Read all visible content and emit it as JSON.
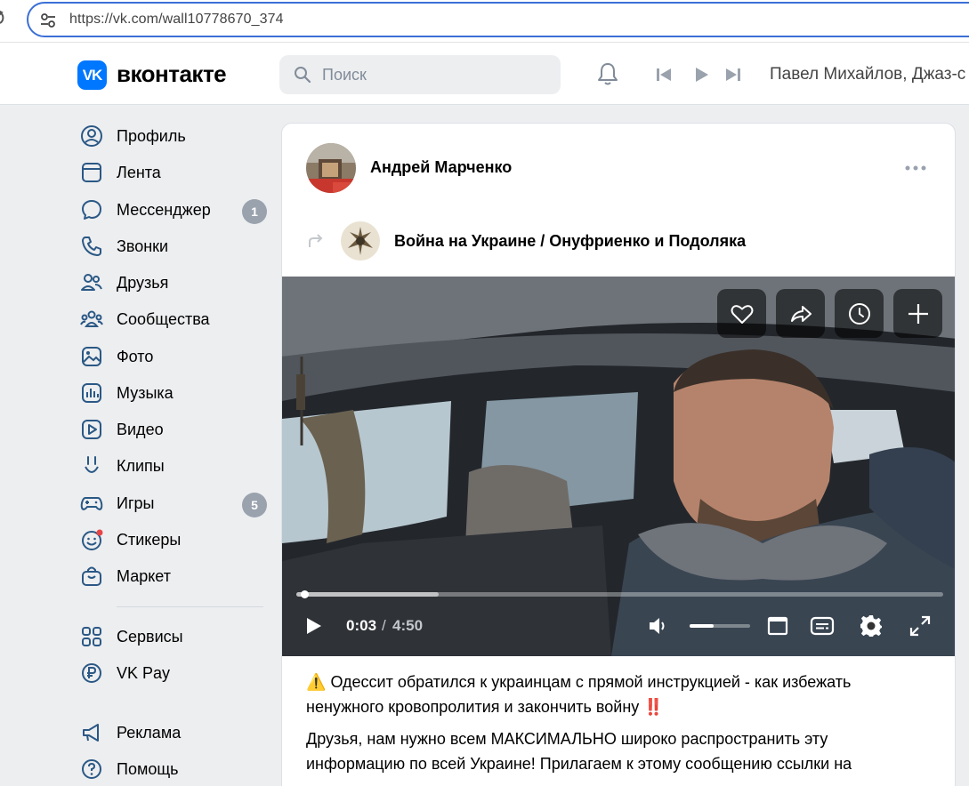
{
  "browser": {
    "url": "https://vk.com/wall10778670_374"
  },
  "header": {
    "logo_text": "VK",
    "wordmark": "вконтакте",
    "search_placeholder": "Поиск",
    "now_playing": "Павел Михайлов, Джаз-с"
  },
  "sidebar": {
    "items": [
      {
        "label": "Профиль",
        "icon": "profile-icon"
      },
      {
        "label": "Лента",
        "icon": "feed-icon"
      },
      {
        "label": "Мессенджер",
        "icon": "messenger-icon",
        "badge": "1"
      },
      {
        "label": "Звонки",
        "icon": "phone-icon"
      },
      {
        "label": "Друзья",
        "icon": "friends-icon"
      },
      {
        "label": "Сообщества",
        "icon": "communities-icon"
      },
      {
        "label": "Фото",
        "icon": "photo-icon"
      },
      {
        "label": "Музыка",
        "icon": "music-icon"
      },
      {
        "label": "Видео",
        "icon": "video-icon"
      },
      {
        "label": "Клипы",
        "icon": "clips-icon"
      },
      {
        "label": "Игры",
        "icon": "games-icon",
        "badge": "5"
      },
      {
        "label": "Стикеры",
        "icon": "stickers-icon"
      },
      {
        "label": "Маркет",
        "icon": "market-icon"
      },
      {
        "label": "Сервисы",
        "icon": "services-icon"
      },
      {
        "label": "VK Pay",
        "icon": "vkpay-icon"
      },
      {
        "label": "Реклама",
        "icon": "ads-icon"
      },
      {
        "label": "Помощь",
        "icon": "help-icon"
      }
    ]
  },
  "post": {
    "author": "Андрей Марченко",
    "source": "Война на Украине / Онуфриенко и Подоляка",
    "video": {
      "current_time": "0:03",
      "separator": "/",
      "duration": "4:50",
      "progress_fraction": 0.01,
      "buffer_fraction": 0.22,
      "volume_fraction": 0.4
    },
    "text_line1": "Одессит обратился к украинцам с прямой инструкцией - как избежать ненужного кровопролития и закончить войну",
    "text_line2": "Друзья, нам нужно всем МАКСИМАЛЬНО широко распространить эту информацию по всей Украине! Прилагаем к этому сообщению ссылки на"
  },
  "colors": {
    "accent": "#0077ff",
    "background": "#edeef0",
    "badge": "#99a2ad",
    "icon_blue": "#2a5885"
  }
}
